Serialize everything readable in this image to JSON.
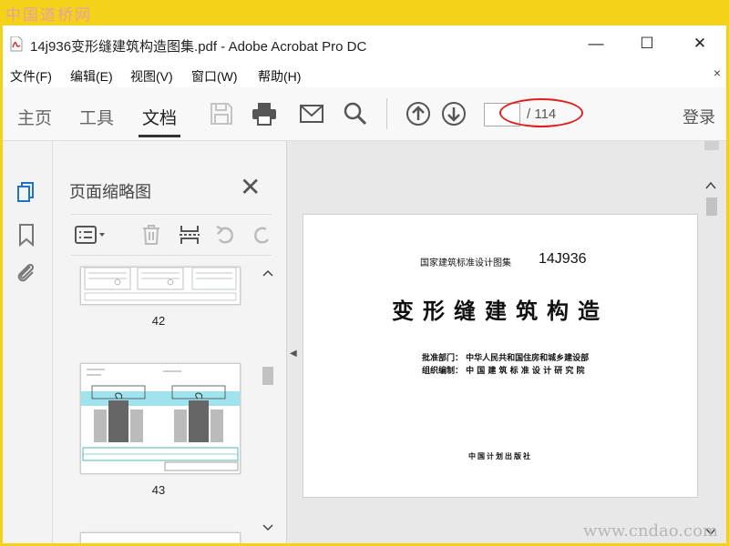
{
  "watermarks": {
    "top_left": "中国道桥网",
    "bottom_right": "www.cndao.com"
  },
  "window": {
    "title": "14j936变形缝建筑构造图集.pdf - Adobe Acrobat Pro DC",
    "controls": {
      "minimize": "—",
      "maximize": "☐",
      "close": "✕"
    }
  },
  "menu": {
    "items": [
      "文件(F)",
      "编辑(E)",
      "视图(V)",
      "窗口(W)",
      "帮助(H)"
    ],
    "close": "×"
  },
  "toolbar": {
    "tabs": [
      "主页",
      "工具",
      "文档"
    ],
    "active_tab": "文档",
    "page_current": "",
    "page_total": "/ 114",
    "login": "登录",
    "highlight_color": "#e02020"
  },
  "thumbnails": {
    "title": "页面缩略图",
    "pages": [
      {
        "number": "42"
      },
      {
        "number": "43"
      }
    ]
  },
  "document": {
    "series": "国家建筑标准设计图集",
    "code": "14J936",
    "title": "变形缝建筑构造",
    "approval": "批准部门：  中华人民共和国住房和城乡建设部",
    "compiler": "组织编制：  中 国 建 筑 标 准 设 计 研 究 院",
    "publisher": "中国计划出版社"
  }
}
